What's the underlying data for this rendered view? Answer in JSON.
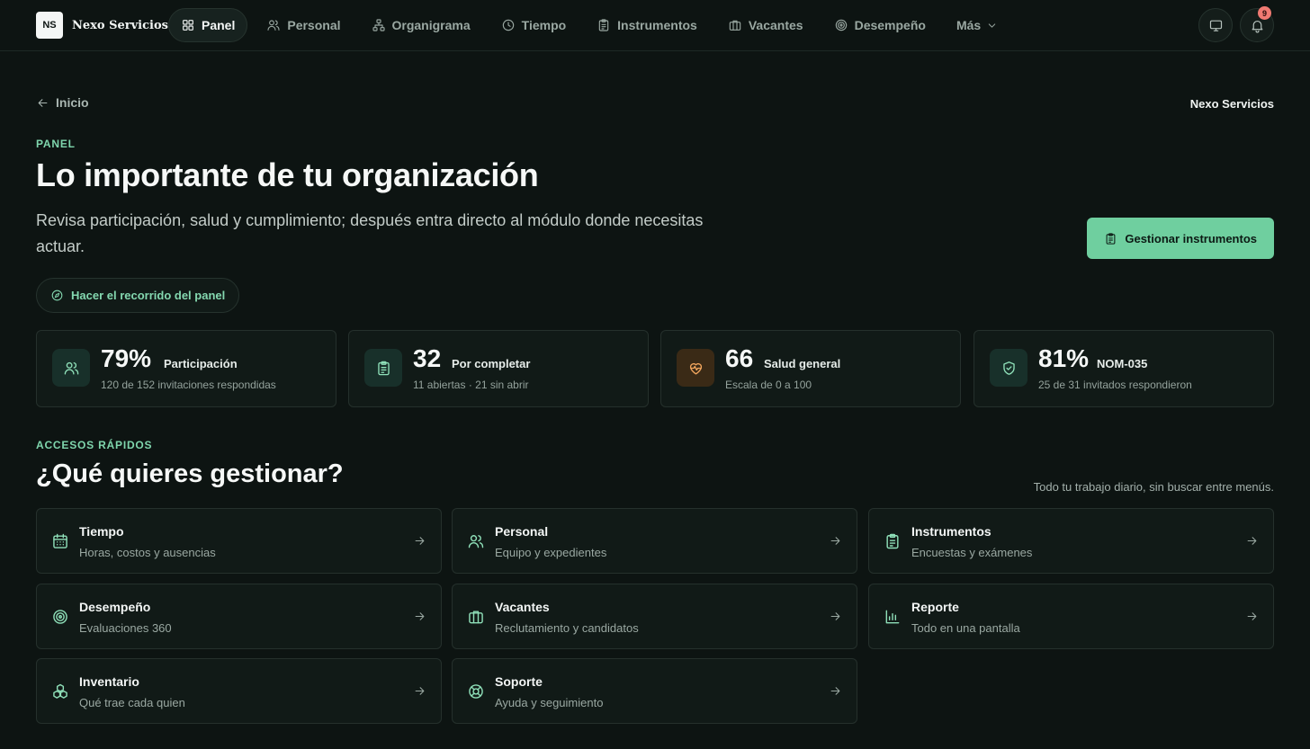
{
  "brand": {
    "initials": "NS",
    "name": "Nexo Servicios"
  },
  "nav": {
    "items": [
      {
        "label": "Panel",
        "icon": "grid-icon",
        "active": true
      },
      {
        "label": "Personal",
        "icon": "users-icon"
      },
      {
        "label": "Organigrama",
        "icon": "org-chart-icon"
      },
      {
        "label": "Tiempo",
        "icon": "clock-icon"
      },
      {
        "label": "Instrumentos",
        "icon": "clipboard-icon"
      },
      {
        "label": "Vacantes",
        "icon": "briefcase-icon"
      },
      {
        "label": "Desempeño",
        "icon": "target-icon"
      },
      {
        "label": "Más",
        "icon": "chevron-down-icon"
      }
    ],
    "notifications_count": "9"
  },
  "header": {
    "back_label": "Inicio",
    "org_name": "Nexo Servicios",
    "eyebrow": "PANEL",
    "title": "Lo importante de tu organización",
    "lead": "Revisa participación, salud y cumplimiento; después entra directo al módulo donde necesitas actuar.",
    "primary_action": "Gestionar instrumentos",
    "tour_action": "Hacer el recorrido del panel"
  },
  "stats": [
    {
      "value": "79%",
      "label": "Participación",
      "sub": "120 de 152 invitaciones respondidas",
      "icon": "users-icon"
    },
    {
      "value": "32",
      "label": "Por completar",
      "sub": "11 abiertas · 21 sin abrir",
      "icon": "clipboard-icon"
    },
    {
      "value": "66",
      "label": "Salud general",
      "sub": "Escala de 0 a 100",
      "icon": "heart-pulse-icon"
    },
    {
      "value": "81%",
      "label": "NOM-035",
      "sub": "25 de 31 invitados respondieron",
      "icon": "shield-check-icon"
    }
  ],
  "quick": {
    "eyebrow": "ACCESOS RÁPIDOS",
    "title": "¿Qué quieres gestionar?",
    "aside": "Todo tu trabajo diario, sin buscar entre menús.",
    "cards": [
      {
        "title": "Tiempo",
        "sub": "Horas, costos y ausencias",
        "icon": "calendar-icon"
      },
      {
        "title": "Personal",
        "sub": "Equipo y expedientes",
        "icon": "users-icon"
      },
      {
        "title": "Instrumentos",
        "sub": "Encuestas y exámenes",
        "icon": "clipboard-icon"
      },
      {
        "title": "Desempeño",
        "sub": "Evaluaciones 360",
        "icon": "target-icon"
      },
      {
        "title": "Vacantes",
        "sub": "Reclutamiento y candidatos",
        "icon": "briefcase-icon"
      },
      {
        "title": "Reporte",
        "sub": "Todo en una pantalla",
        "icon": "bar-chart-icon"
      },
      {
        "title": "Inventario",
        "sub": "Qué trae cada quien",
        "icon": "boxes-icon"
      },
      {
        "title": "Soporte",
        "sub": "Ayuda y seguimiento",
        "icon": "lifebuoy-icon"
      }
    ]
  },
  "colors": {
    "background": "#0d1412",
    "accent": "#6fcf9f",
    "card": "#111a17",
    "warm": "#f2a65e",
    "badge": "#f07a72"
  }
}
